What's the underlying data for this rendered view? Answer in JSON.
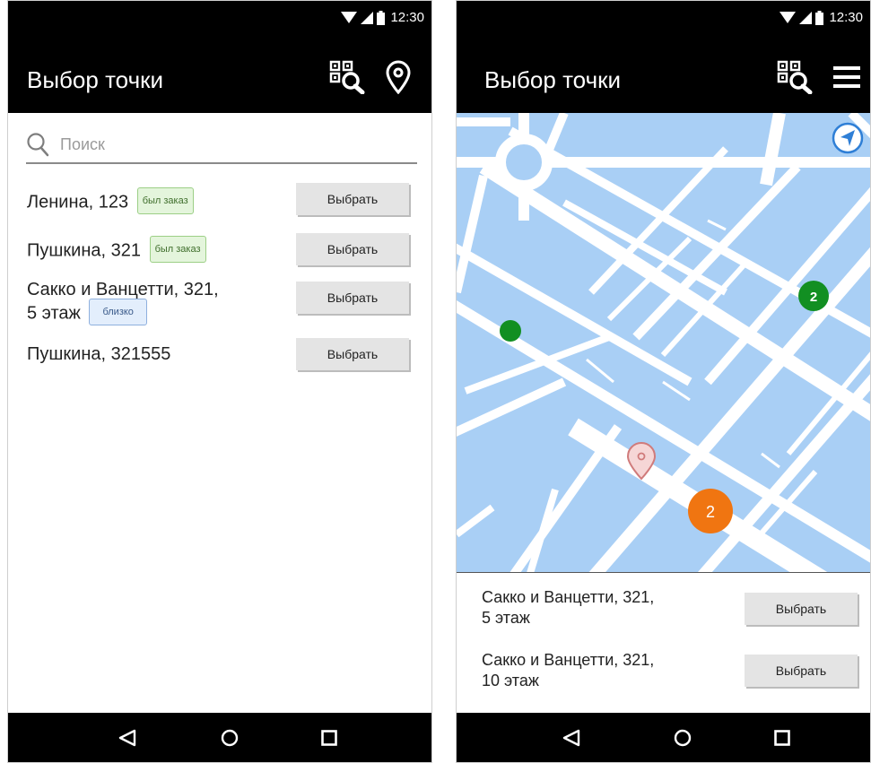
{
  "status": {
    "time": "12:30"
  },
  "left": {
    "title": "Выбор точки",
    "search": {
      "placeholder": "Поиск",
      "value": ""
    },
    "items": [
      {
        "line1": "Ленина, 123",
        "badge": "был заказ",
        "badge_kind": "green",
        "button": "Выбрать"
      },
      {
        "line1": "Пушкина, 321",
        "badge": "был заказ",
        "badge_kind": "green",
        "button": "Выбрать"
      },
      {
        "line1": "Сакко и Ванцетти, 321,",
        "line2": "5 этаж",
        "badge": "близко",
        "badge_kind": "blue",
        "button": "Выбрать"
      },
      {
        "line1": "Пушкина, 321555",
        "button": "Выбрать"
      }
    ]
  },
  "right": {
    "title": "Выбор точки",
    "map": {
      "cluster_small_label": "2",
      "cluster_large_label": "2",
      "colors": {
        "block": "#a9cff5",
        "road": "#ffffff",
        "cluster_green": "#128f22",
        "cluster_orange": "#f07511",
        "locate": "#2f7fd6"
      }
    },
    "items": [
      {
        "line1": "Сакко и Ванцетти, 321,",
        "line2": "5 этаж",
        "button": "Выбрать"
      },
      {
        "line1": "Сакко и Ванцетти, 321,",
        "line2": "10 этаж",
        "button": "Выбрать"
      }
    ]
  },
  "icons": {
    "qr_search": "qr-search-icon",
    "location_pin": "map-pin-icon",
    "menu": "hamburger-menu-icon",
    "back": "back-triangle-icon",
    "home": "home-circle-icon",
    "recents": "recents-square-icon"
  }
}
